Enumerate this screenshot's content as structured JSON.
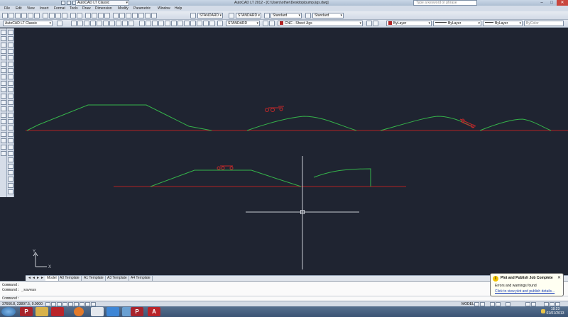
{
  "titlebar": {
    "title": "AutoCAD LT 2012 - [C:\\Users\\other\\Desktop\\pump jigs.dwg]",
    "workspace": "AutoCAD LT Classic",
    "search_placeholder": "Type a keyword or phrase"
  },
  "menu": [
    "File",
    "Edit",
    "View",
    "Insert",
    "Format",
    "Tools",
    "Draw",
    "Dimension",
    "Modify",
    "Parametric",
    "Window",
    "Help"
  ],
  "toolbar1": {
    "text_style": "STANDARD",
    "dim_style": "STANDARD",
    "table_style": "Standard",
    "mleader_style": "Standard"
  },
  "toolbar2": {
    "workspace": "AutoCAD LT Classic",
    "annotation_scale": "STANDARD",
    "layer": "CNC - Sheet Jigs",
    "color": "ByLayer",
    "linetype": "ByLayer",
    "lineweight": "ByLayer",
    "plotstyle": "ByColor"
  },
  "layout_tabs": [
    "Model",
    "A0 Template",
    "A1 Template",
    "A3 Template",
    "A4 Template"
  ],
  "command": {
    "lines": [
      "Command:",
      "Command:  _saveas"
    ],
    "prompt": "Command:"
  },
  "status": {
    "coords": "37666.8, 23897.5, 0.0000",
    "model_label": "MODEL"
  },
  "notification": {
    "title": "Plot and Publish Job Complete",
    "body": "Errors and warnings found",
    "link": "Click to view plot and publish details..."
  },
  "taskbar": {
    "time": "18:23",
    "date": "01/01/2013",
    "apps": [
      "autocad-p",
      "explorer",
      "acrobat",
      "firefox",
      "notepad",
      "dropbox",
      "photos",
      "autocad-p-2",
      "acrobat-2"
    ]
  },
  "colors": {
    "canvas": "#1f2431",
    "profile_green": "#35b34a",
    "baseline_red": "#b22222",
    "crosshair": "#c8ccd4"
  }
}
